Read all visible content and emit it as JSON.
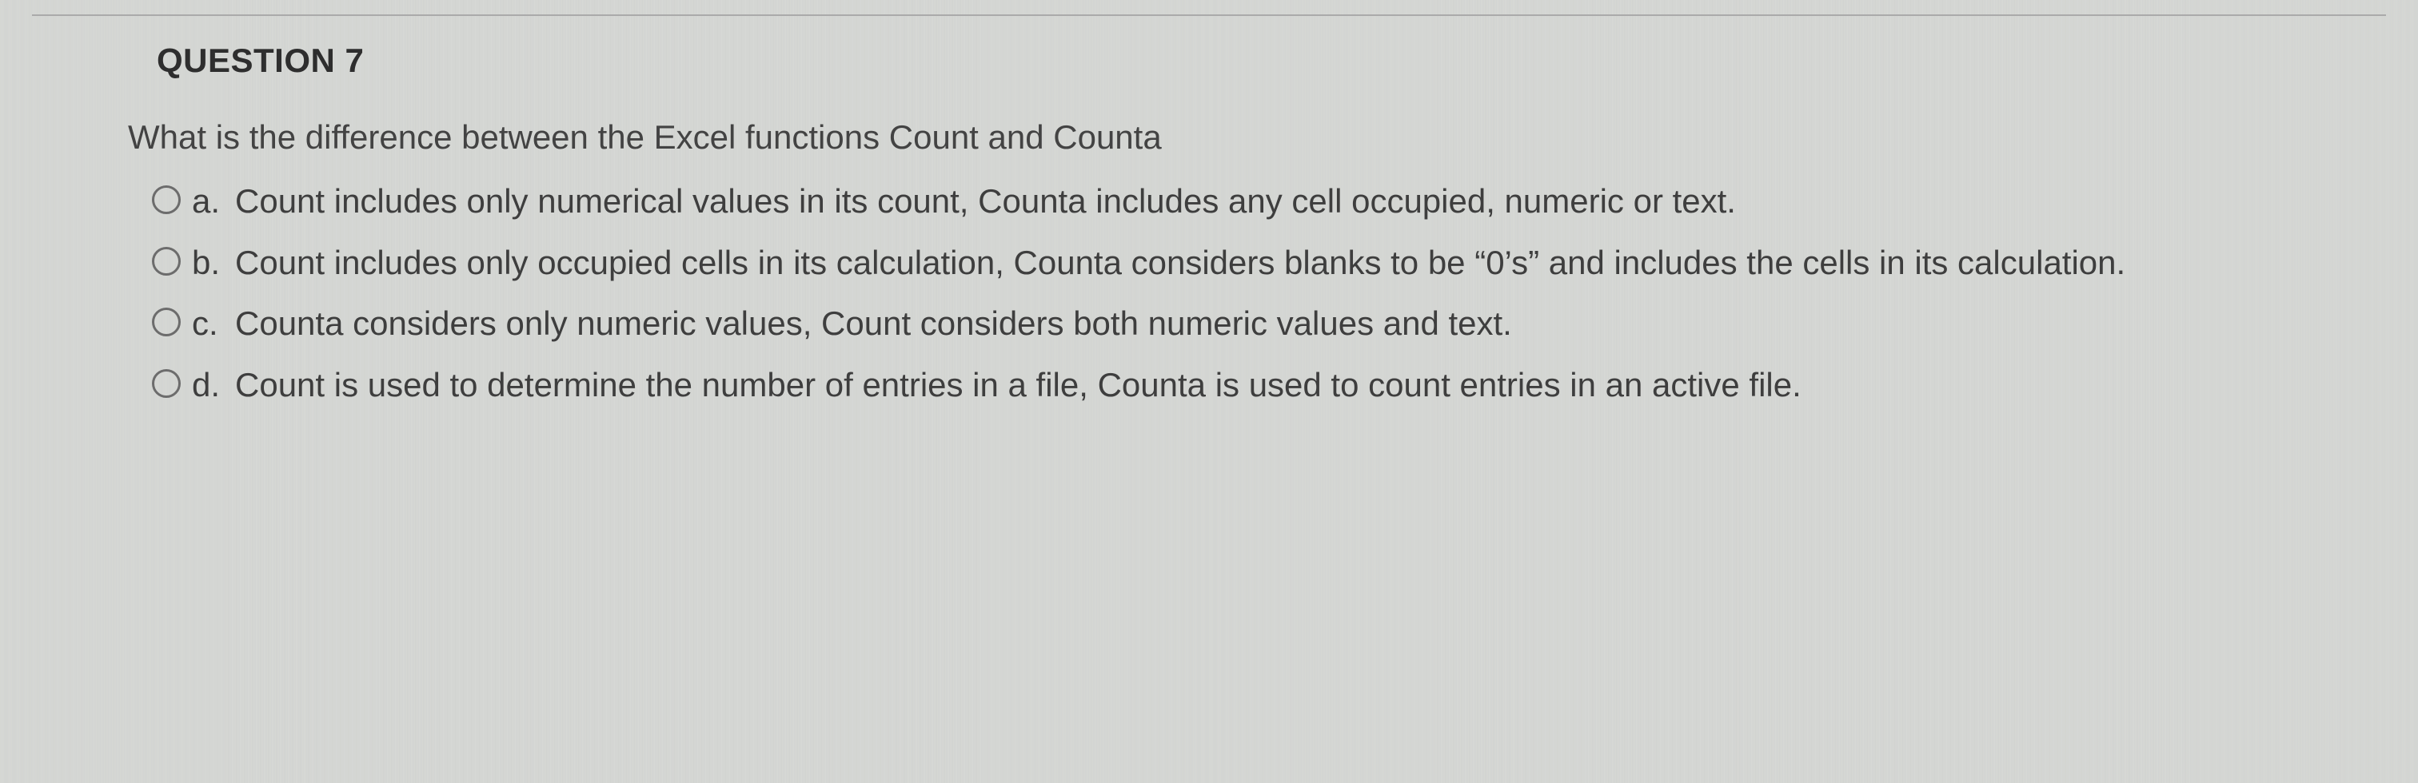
{
  "question": {
    "header": "QUESTION 7",
    "prompt": "What is the difference between the Excel functions Count and Counta",
    "options": [
      {
        "letter": "a.",
        "text": "Count includes only numerical values in its count, Counta includes any cell occupied, numeric or text."
      },
      {
        "letter": "b.",
        "text": "Count includes only occupied cells in its calculation, Counta considers blanks to be “0’s” and includes the cells in its calculation."
      },
      {
        "letter": "c.",
        "text": "Counta considers only numeric values, Count considers both numeric values and text."
      },
      {
        "letter": "d.",
        "text": "Count is used to determine the number of entries in a file, Counta is used to count entries in an active file."
      }
    ]
  }
}
